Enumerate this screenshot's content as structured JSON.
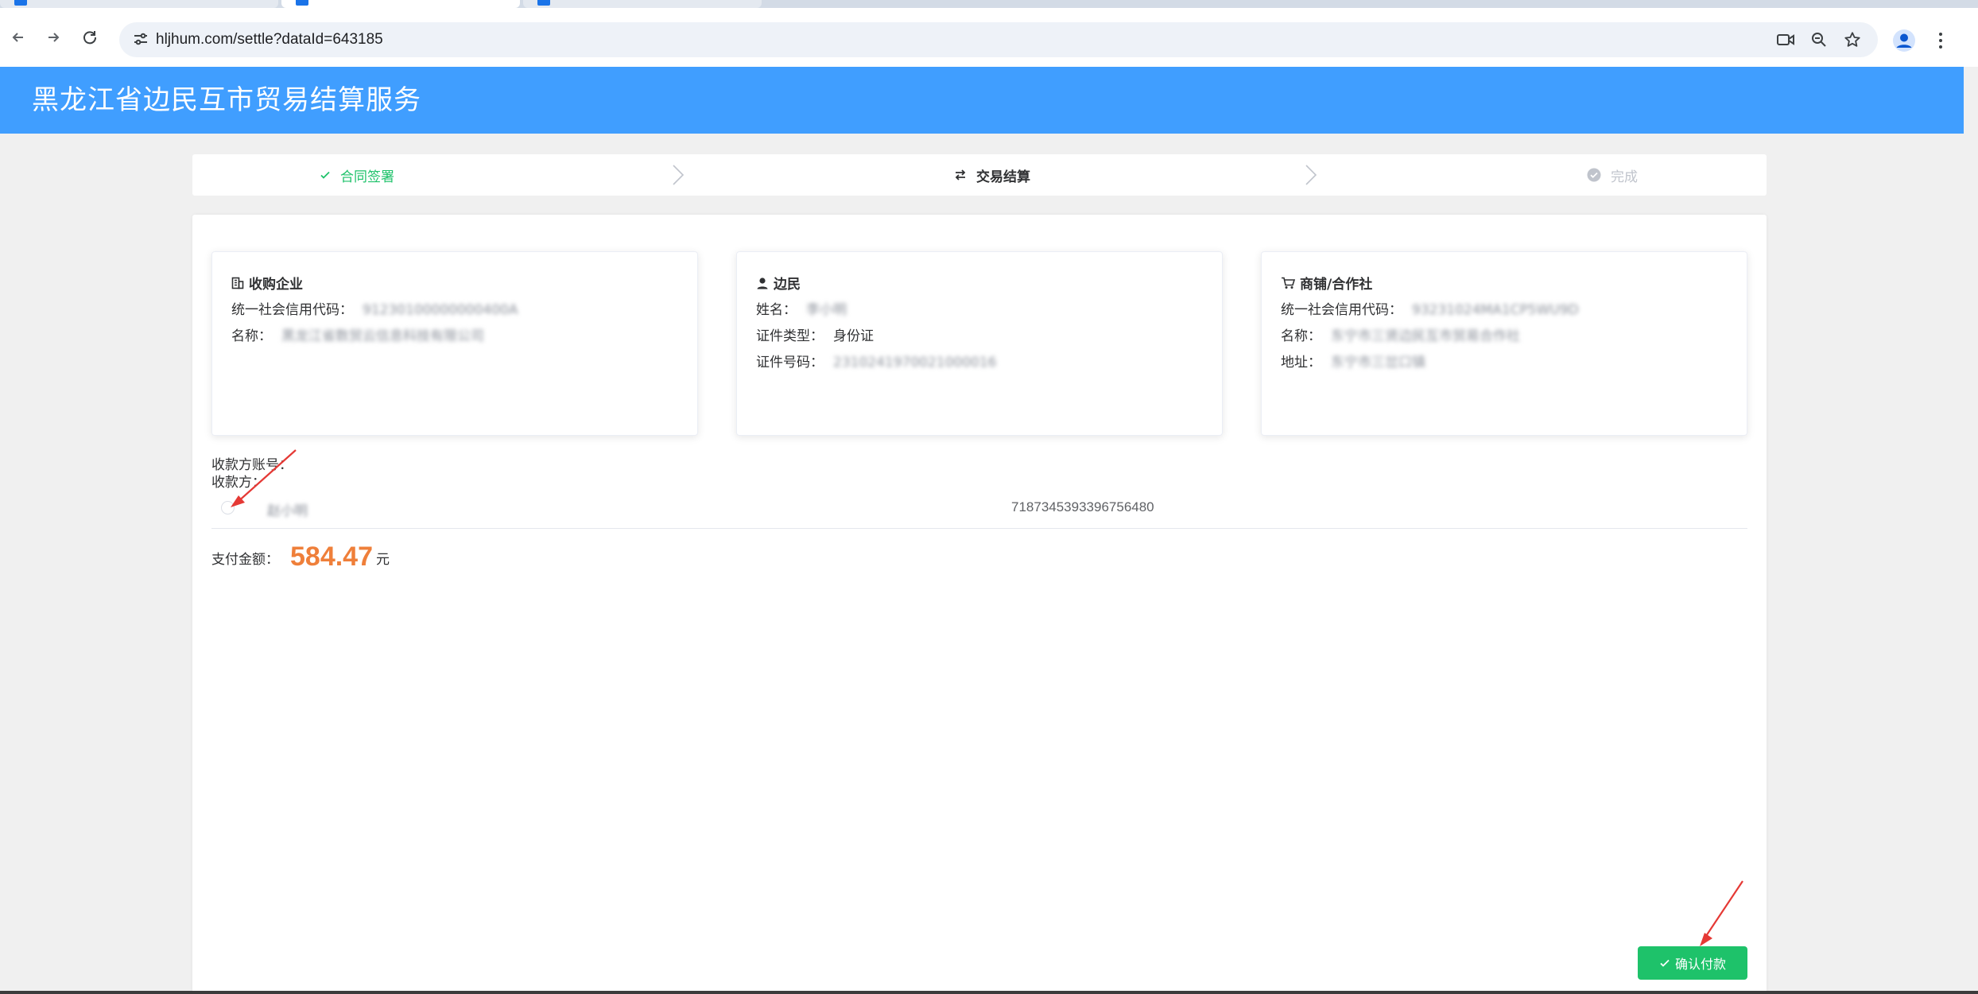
{
  "browser": {
    "url": "hljhum.com/settle?dataId=643185",
    "icons": [
      "back-arrow-icon",
      "forward-arrow-icon",
      "reload-icon",
      "site-settings-icon",
      "camera-icon",
      "zoom-icon",
      "bookmark-star-icon",
      "profile-icon",
      "more-menu-icon"
    ]
  },
  "header": {
    "title": "黑龙江省边民互市贸易结算服务",
    "color": "#409eff"
  },
  "steps": [
    {
      "label": "合同签署",
      "state": "done",
      "icon": "check-icon",
      "color": "#1ec26a"
    },
    {
      "label": "交易结算",
      "state": "active",
      "icon": "exchange-icon",
      "color": "#303133"
    },
    {
      "label": "完成",
      "state": "pending",
      "icon": "check-circle-icon",
      "color": "#c0c4cc"
    }
  ],
  "buyer": {
    "title": "收购企业",
    "credit_code_label": "统一社会信用代码：",
    "credit_code": "91230100000000400A",
    "name_label": "名称：",
    "name": "黑龙江省数贸云信息科技有限公司"
  },
  "border_resident": {
    "title": "边民",
    "name_label": "姓名：",
    "name": "李小明",
    "id_type_label": "证件类型：",
    "id_type": "身份证",
    "id_no_label": "证件号码：",
    "id_no": "2310241970021000016"
  },
  "merchant": {
    "title": "商铺/合作社",
    "credit_code_label": "统一社会信用代码：",
    "credit_code": "93231024MA1CP5WU9D",
    "name_label": "名称：",
    "name": "东宁市三贤边民互市贸易合作社",
    "address_label": "地址：",
    "address": "东宁市三岔口镇"
  },
  "payee": {
    "account_label": "收款方账号：",
    "payee_label": "收款方：",
    "name": "赵小明",
    "account": "7187345393396756480"
  },
  "payment": {
    "label": "支付金额：",
    "amount": "584.47",
    "unit": "元",
    "amount_color": "#ef7f3a"
  },
  "actions": {
    "confirm_label": "确认付款",
    "confirm_color": "#1ec26a"
  }
}
